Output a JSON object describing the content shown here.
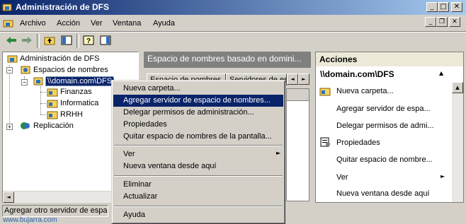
{
  "window": {
    "title": "Administración de DFS",
    "caption_buttons": {
      "minimize": "_",
      "maximize": "□",
      "close": "✕"
    }
  },
  "menubar": {
    "items": [
      "Archivo",
      "Acción",
      "Ver",
      "Ventana",
      "Ayuda"
    ],
    "mdi_buttons": [
      "_",
      "❐",
      "✕"
    ]
  },
  "toolbar": {
    "icons": [
      "back-arrow-icon",
      "forward-arrow-icon",
      "up-folder-icon",
      "show-hide-tree-icon",
      "help-icon",
      "show-hide-action-pane-icon"
    ]
  },
  "tree": {
    "root": "Administración de DFS",
    "namespaces": "Espacios de nombres",
    "namespace_node": "\\\\domain.com\\DFS",
    "folders": [
      "Finanzas",
      "Informatica",
      "RRHH"
    ],
    "replication": "Replicación",
    "expanders": {
      "minus": "−",
      "plus": "+"
    }
  },
  "middle": {
    "header": "Espacio de nombres basado en domini...",
    "tabs": [
      "Espacio de nombres",
      "Servidores de es..."
    ],
    "tab_scroll": {
      "left": "◄",
      "right": "►"
    }
  },
  "actions": {
    "header": "Acciones",
    "context": "\\\\domain.com\\DFS",
    "items": [
      "Nueva carpeta...",
      "Agregar servidor de espa...",
      "Delegar permisos de admi...",
      "Propiedades",
      "Quitar espacio de nombre...",
      "Ver",
      "Nueva ventana desde aquí"
    ],
    "collapse_glyph": "▲",
    "submenu_glyph": "►"
  },
  "context_menu": {
    "items": [
      "Nueva carpeta...",
      "Agregar servidor de espacio de nombres...",
      "Delegar permisos de administración...",
      "Propiedades",
      "Quitar espacio de nombres de la pantalla...",
      "Ver",
      "Nueva ventana desde aquí",
      "Eliminar",
      "Actualizar",
      "Ayuda"
    ],
    "selected_index": 1,
    "submenu_glyph": "►"
  },
  "status": {
    "text": "Agregar otro servidor de espacio",
    "watermark": "www.bujarra.com"
  },
  "colors": {
    "titlebar_start": "#0a246a",
    "titlebar_end": "#a6caf0",
    "selection": "#0a246a",
    "face": "#d4d0c8"
  }
}
